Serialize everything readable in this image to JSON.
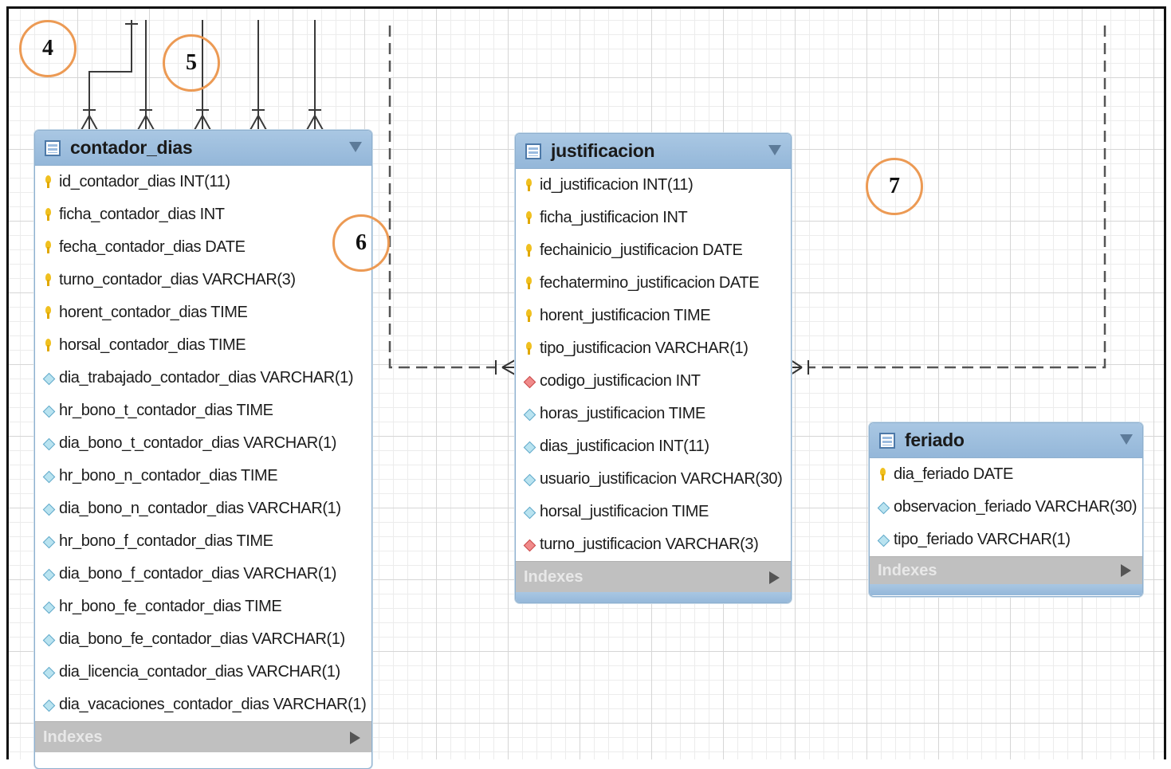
{
  "diagram": {
    "markers": [
      "4",
      "5",
      "6",
      "7"
    ],
    "tables": {
      "contador_dias": {
        "title": "contador_dias",
        "columns": [
          {
            "text": "id_contador_dias INT(11)",
            "icon": "primary-key-icon"
          },
          {
            "text": "ficha_contador_dias INT",
            "icon": "primary-key-icon"
          },
          {
            "text": "fecha_contador_dias DATE",
            "icon": "primary-key-icon"
          },
          {
            "text": "turno_contador_dias VARCHAR(3)",
            "icon": "primary-key-icon"
          },
          {
            "text": "horent_contador_dias TIME",
            "icon": "primary-key-icon"
          },
          {
            "text": "horsal_contador_dias TIME",
            "icon": "primary-key-icon"
          },
          {
            "text": "dia_trabajado_contador_dias VARCHAR(1)",
            "icon": "column-icon"
          },
          {
            "text": "hr_bono_t_contador_dias TIME",
            "icon": "column-icon"
          },
          {
            "text": "dia_bono_t_contador_dias VARCHAR(1)",
            "icon": "column-icon"
          },
          {
            "text": "hr_bono_n_contador_dias TIME",
            "icon": "column-icon"
          },
          {
            "text": "dia_bono_n_contador_dias VARCHAR(1)",
            "icon": "column-icon"
          },
          {
            "text": "hr_bono_f_contador_dias TIME",
            "icon": "column-icon"
          },
          {
            "text": "dia_bono_f_contador_dias VARCHAR(1)",
            "icon": "column-icon"
          },
          {
            "text": "hr_bono_fe_contador_dias TIME",
            "icon": "column-icon"
          },
          {
            "text": "dia_bono_fe_contador_dias VARCHAR(1)",
            "icon": "column-icon"
          },
          {
            "text": "dia_licencia_contador_dias VARCHAR(1)",
            "icon": "column-icon"
          },
          {
            "text": "dia_vacaciones_contador_dias VARCHAR(1)",
            "icon": "column-icon"
          }
        ],
        "indexes_label": "Indexes"
      },
      "justificacion": {
        "title": "justificacion",
        "columns": [
          {
            "text": "id_justificacion INT(11)",
            "icon": "primary-key-icon"
          },
          {
            "text": "ficha_justificacion INT",
            "icon": "primary-key-icon"
          },
          {
            "text": "fechainicio_justificacion DATE",
            "icon": "primary-key-icon"
          },
          {
            "text": "fechatermino_justificacion DATE",
            "icon": "primary-key-icon"
          },
          {
            "text": "horent_justificacion TIME",
            "icon": "primary-key-icon"
          },
          {
            "text": "tipo_justificacion VARCHAR(1)",
            "icon": "primary-key-icon"
          },
          {
            "text": "codigo_justificacion INT",
            "icon": "foreign-key-icon"
          },
          {
            "text": "horas_justificacion TIME",
            "icon": "column-icon"
          },
          {
            "text": "dias_justificacion INT(11)",
            "icon": "column-icon"
          },
          {
            "text": "usuario_justificacion VARCHAR(30)",
            "icon": "column-icon"
          },
          {
            "text": "horsal_justificacion TIME",
            "icon": "column-icon"
          },
          {
            "text": "turno_justificacion VARCHAR(3)",
            "icon": "foreign-key-icon"
          }
        ],
        "indexes_label": "Indexes"
      },
      "feriado": {
        "title": "feriado",
        "columns": [
          {
            "text": "dia_feriado DATE",
            "icon": "primary-key-icon"
          },
          {
            "text": "observacion_feriado VARCHAR(30)",
            "icon": "column-icon"
          },
          {
            "text": "tipo_feriado VARCHAR(1)",
            "icon": "column-icon"
          }
        ],
        "indexes_label": "Indexes"
      }
    },
    "colors": {
      "marker_outline": "#ec9a54",
      "header_blue": "#9dbfe0",
      "primary_key": "#f0c020",
      "foreign_key": "#e06060",
      "column": "#7ccbe3",
      "indexes_bar": "#c0c0c0"
    }
  }
}
